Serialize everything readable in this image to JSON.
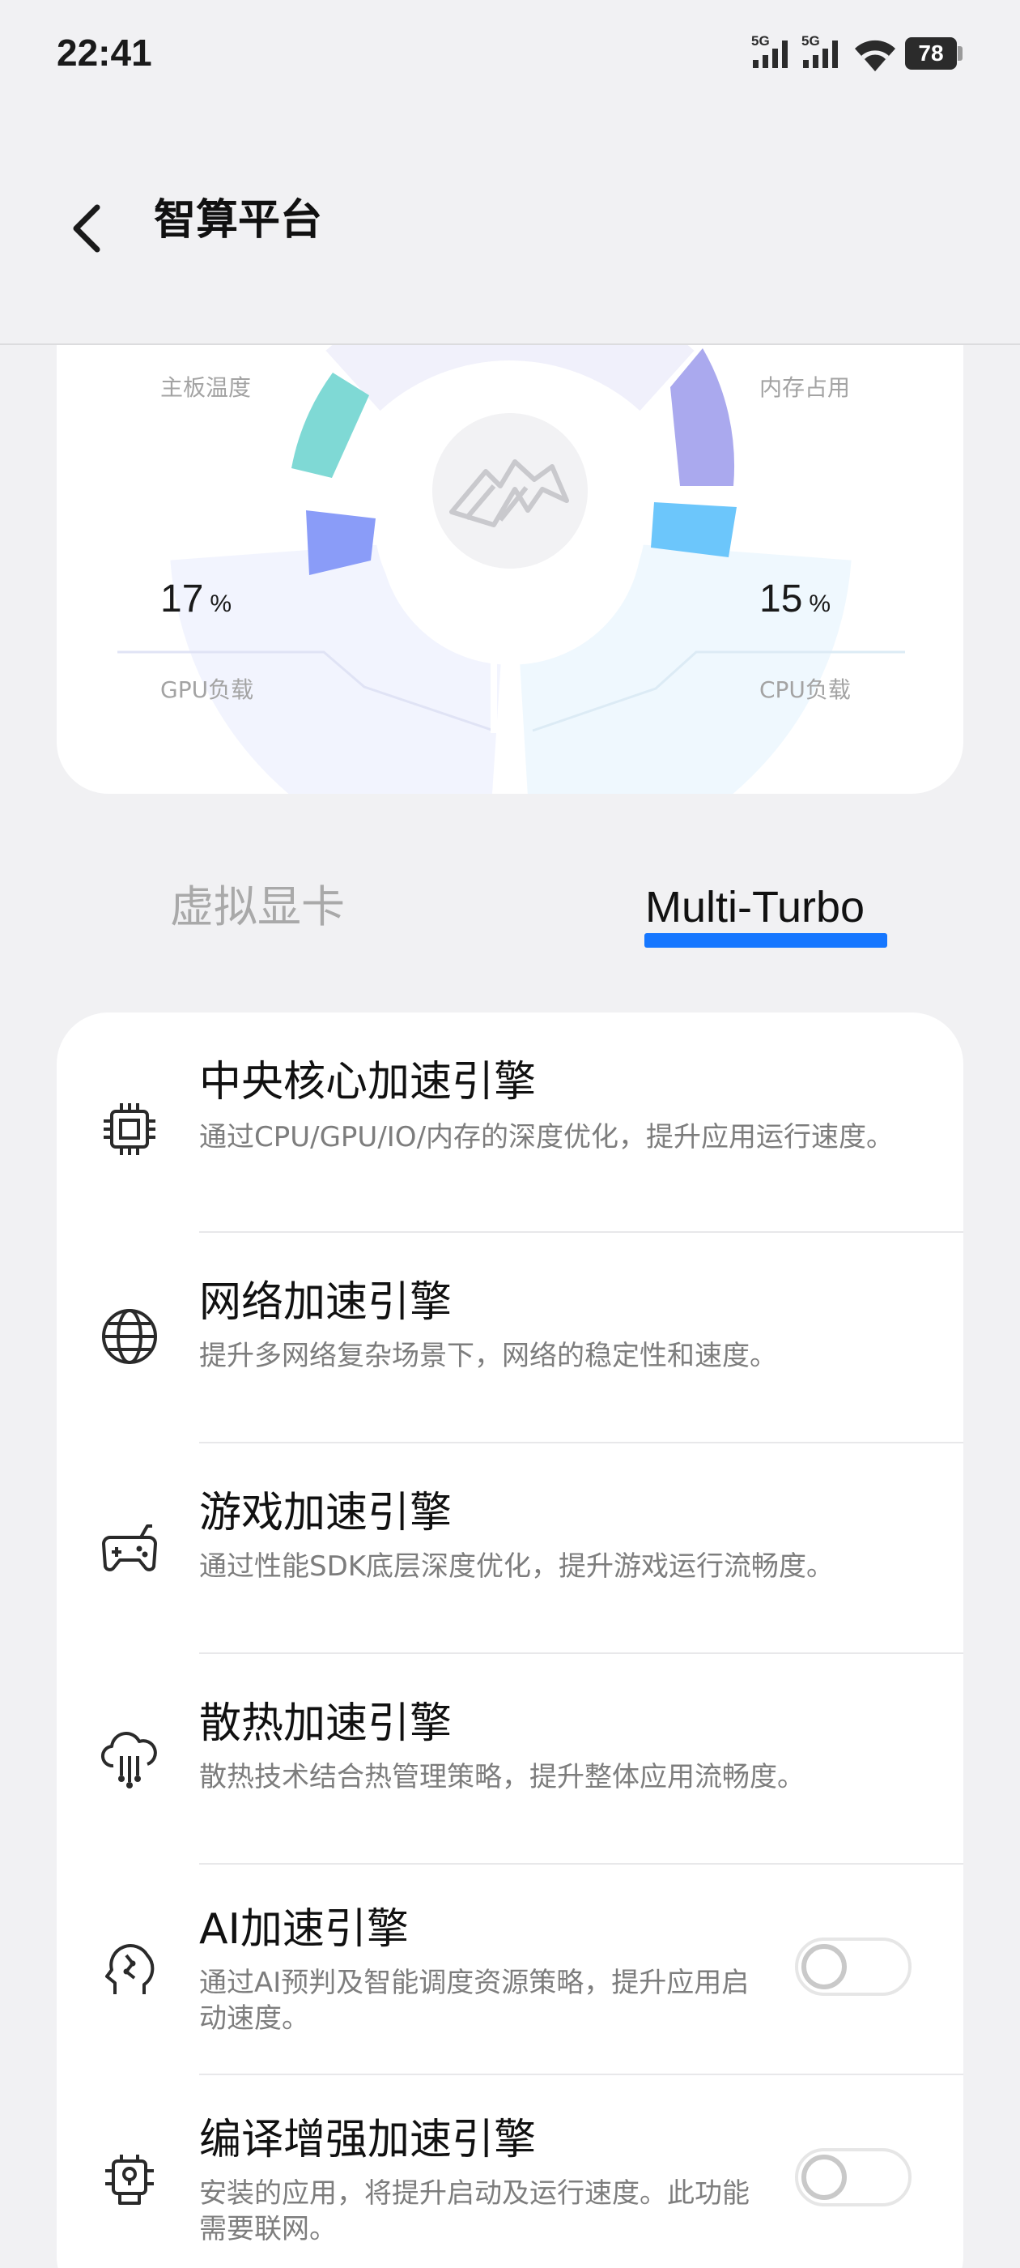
{
  "status_bar": {
    "time": "22:41",
    "sim1": "5G",
    "sim2": "5G",
    "battery": "78"
  },
  "header": {
    "title": "智算平台"
  },
  "stats": {
    "board_temp_label": "主板温度",
    "memory_label": "内存占用",
    "gpu_value": "17",
    "gpu_unit": "%",
    "gpu_label": "GPU负载",
    "cpu_value": "15",
    "cpu_unit": "%",
    "cpu_label": "CPU负载"
  },
  "tabs": [
    {
      "label": "虚拟显卡",
      "selected": false
    },
    {
      "label": "Multi-Turbo",
      "selected": true
    }
  ],
  "engines": [
    {
      "name": "中央核心加速引擎",
      "desc": "通过CPU/GPU/IO/内存的深度优化，提升应用运行速度。",
      "icon": "cpu-chip-icon"
    },
    {
      "name": "网络加速引擎",
      "desc": "提升多网络复杂场景下，网络的稳定性和速度。",
      "icon": "globe-icon"
    },
    {
      "name": "游戏加速引擎",
      "desc": "通过性能SDK底层深度优化，提升游戏运行流畅度。",
      "icon": "gamepad-icon"
    },
    {
      "name": "散热加速引擎",
      "desc": "散热技术结合热管理策略，提升整体应用流畅度。",
      "icon": "cloud-cooling-icon"
    },
    {
      "name": "AI加速引擎",
      "desc": "通过AI预判及智能调度资源策略，提升应用启动速度。",
      "icon": "ai-head-icon",
      "toggle": false
    },
    {
      "name": "编译增强加速引擎",
      "desc": "安装的应用，将提升启动及运行速度。此功能需要联网。",
      "icon": "compile-chip-icon",
      "toggle": false
    }
  ],
  "colors": {
    "accent": "#1677ff",
    "teal": "#7fd9d5",
    "lavender": "#aaa9ee",
    "periwinkle": "#8a9cf8",
    "sky": "#6cc6fb"
  }
}
